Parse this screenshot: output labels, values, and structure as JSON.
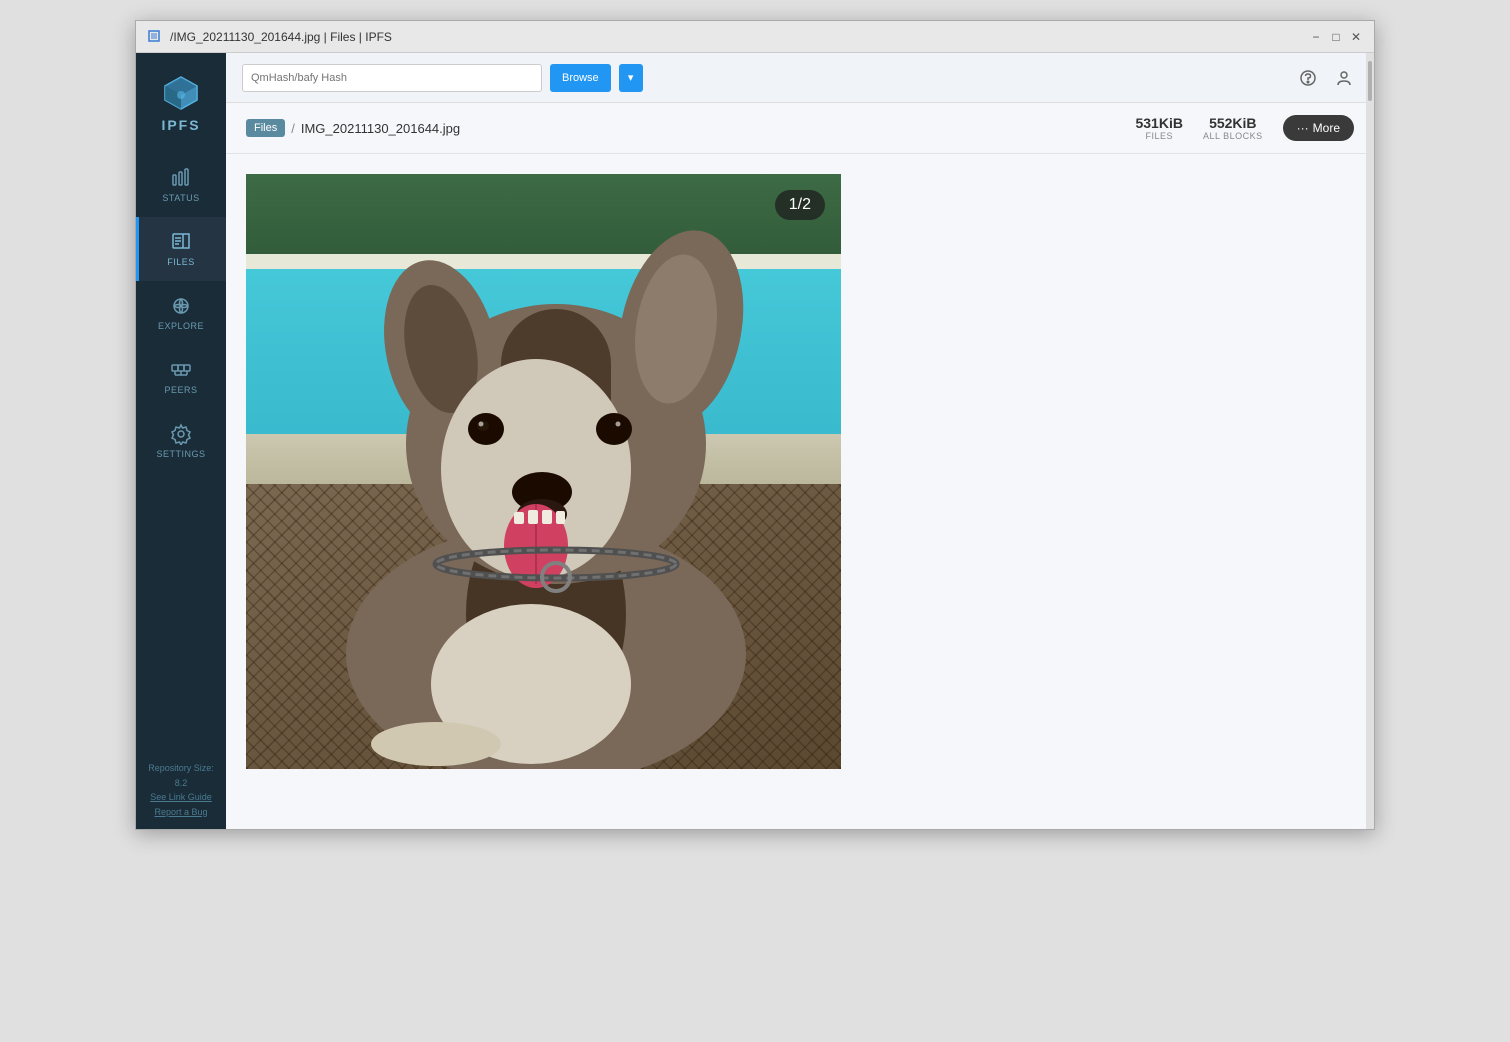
{
  "window": {
    "title": "/IMG_20211130_201644.jpg | Files | IPFS",
    "icon_alt": "IPFS logo"
  },
  "titlebar": {
    "minimize": "−",
    "maximize": "□",
    "close": "✕"
  },
  "topbar": {
    "search_placeholder": "QmHash/bafy Hash",
    "search_button": "Browse",
    "help_icon": "?",
    "user_icon": "@"
  },
  "sidebar": {
    "logo_text": "IPFS",
    "items": [
      {
        "id": "status",
        "label": "STATUS",
        "active": false
      },
      {
        "id": "files",
        "label": "FILES",
        "active": true
      },
      {
        "id": "explore",
        "label": "EXPLORE",
        "active": false
      },
      {
        "id": "peers",
        "label": "PEERS",
        "active": false
      },
      {
        "id": "settings",
        "label": "SETTINGS",
        "active": false
      }
    ],
    "footer": {
      "line1": "Repository Size: 8.2",
      "line2": "See Link Guide",
      "line3": "Report a Bug"
    }
  },
  "fileheader": {
    "breadcrumb_files_btn": "Files",
    "separator": "/",
    "filename": "IMG_20211130_201644.jpg",
    "stat_files_value": "531KiB",
    "stat_files_label": "FILES",
    "stat_blocks_value": "552KiB",
    "stat_blocks_label": "ALL BLOCKS",
    "more_btn_dots": "···",
    "more_btn_label": "More"
  },
  "imageviewer": {
    "counter": "1/2",
    "image_alt": "Dog photo - husky mix by pool"
  },
  "colors": {
    "sidebar_bg": "#1a2c38",
    "active_indicator": "#2196f3",
    "topbar_bg": "#f0f4f8",
    "main_bg": "#f5f7fa",
    "more_btn_bg": "#3a3a3a",
    "search_btn_bg": "#2196f3"
  }
}
